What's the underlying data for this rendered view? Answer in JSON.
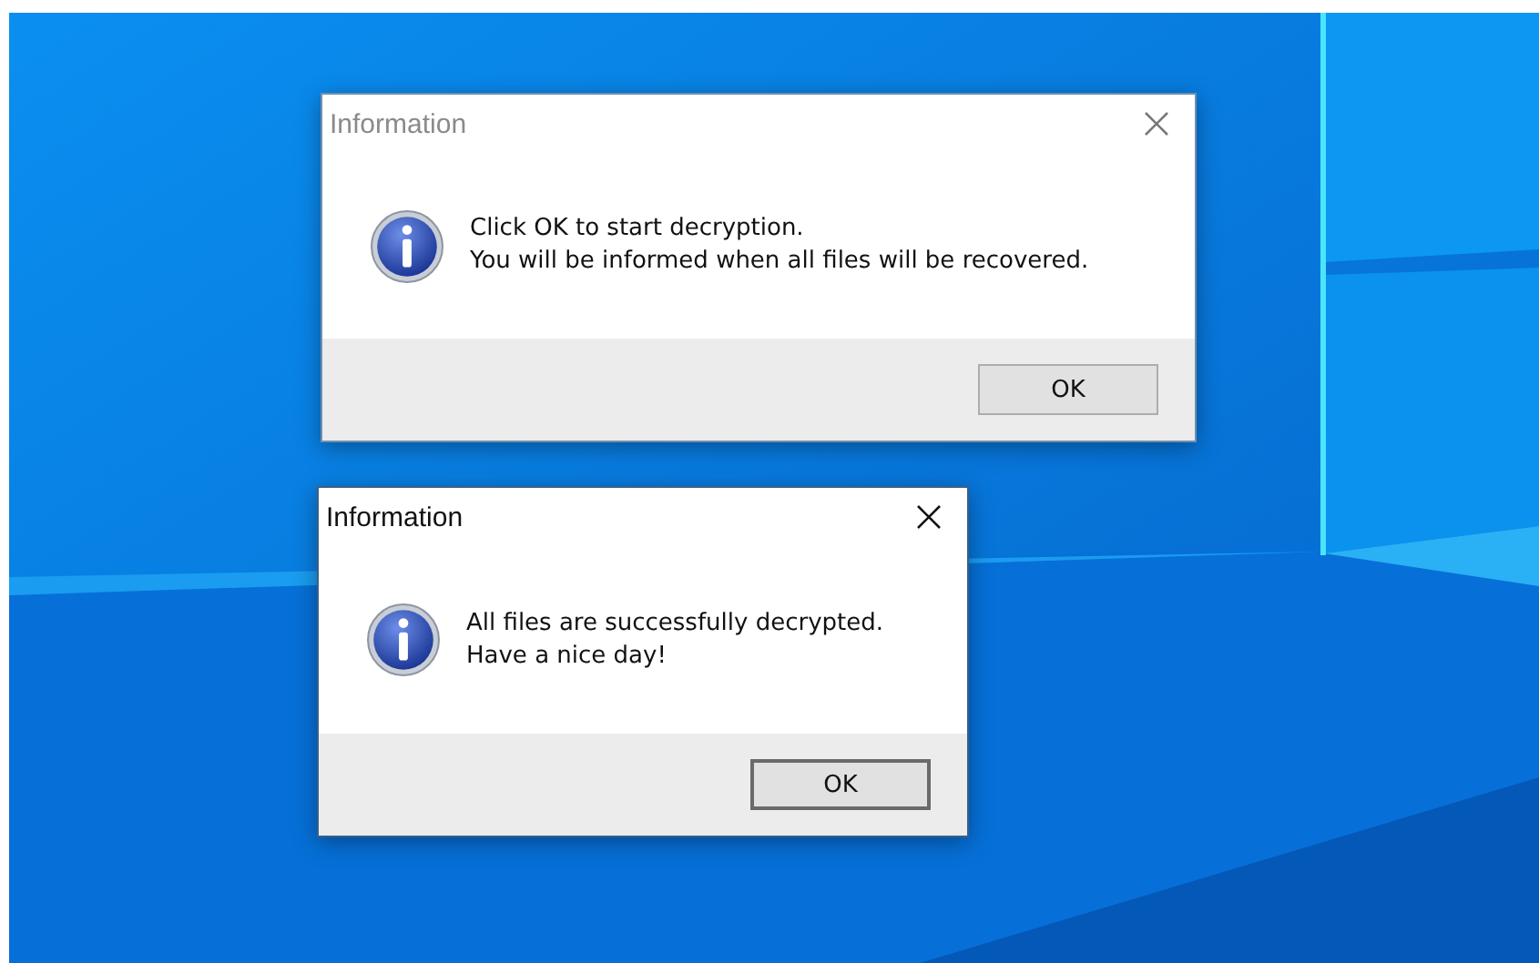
{
  "dialogs": [
    {
      "title": "Information",
      "active": false,
      "message_lines": [
        "Click OK to start decryption.",
        "You will be informed when all files will be recovered."
      ],
      "button": "OK",
      "focused": false
    },
    {
      "title": "Information",
      "active": true,
      "message_lines": [
        "All files are successfully decrypted.",
        "Have a nice day!"
      ],
      "button": "OK",
      "focused": true
    }
  ]
}
